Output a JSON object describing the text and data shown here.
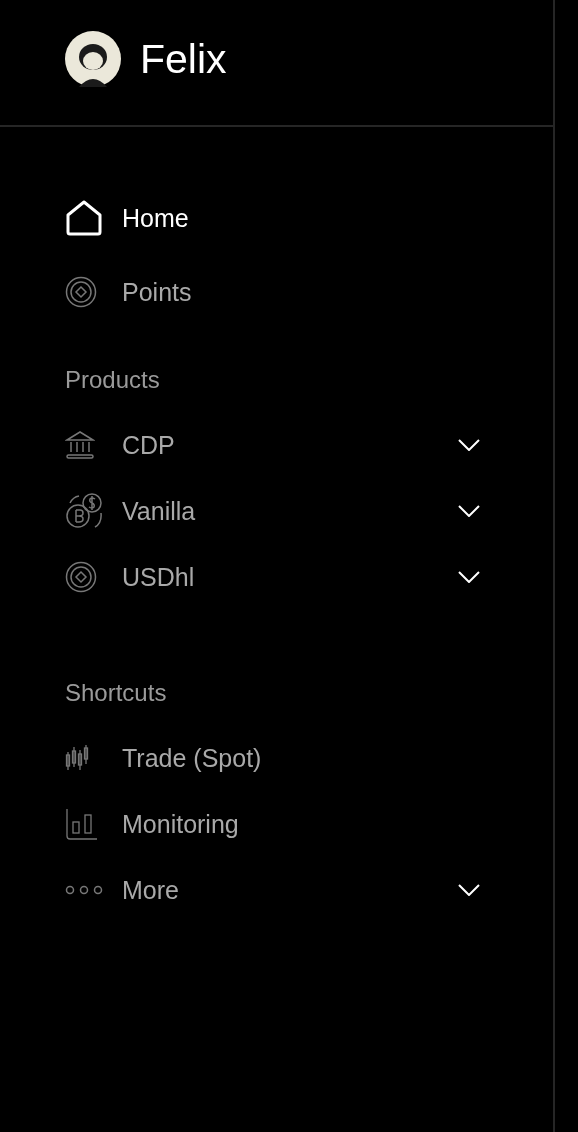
{
  "header": {
    "title": "Felix"
  },
  "sections": [
    {
      "items": [
        {
          "label": "Home",
          "selected": true,
          "kind": "link"
        },
        {
          "label": "Points",
          "selected": false,
          "kind": "link"
        }
      ]
    },
    {
      "heading": "Products",
      "items": [
        {
          "label": "CDP",
          "selected": false,
          "kind": "menu",
          "expanded": false
        },
        {
          "label": "Vanilla",
          "selected": false,
          "kind": "menu",
          "expanded": false
        },
        {
          "label": "USDhl",
          "selected": false,
          "kind": "menu",
          "expanded": false
        }
      ]
    },
    {
      "heading": "Shortcuts",
      "items": [
        {
          "label": "Trade (Spot)",
          "selected": false,
          "kind": "link"
        },
        {
          "label": "Monitoring",
          "selected": false,
          "kind": "link"
        },
        {
          "label": "More",
          "selected": false,
          "kind": "menu",
          "expanded": false
        }
      ]
    }
  ]
}
